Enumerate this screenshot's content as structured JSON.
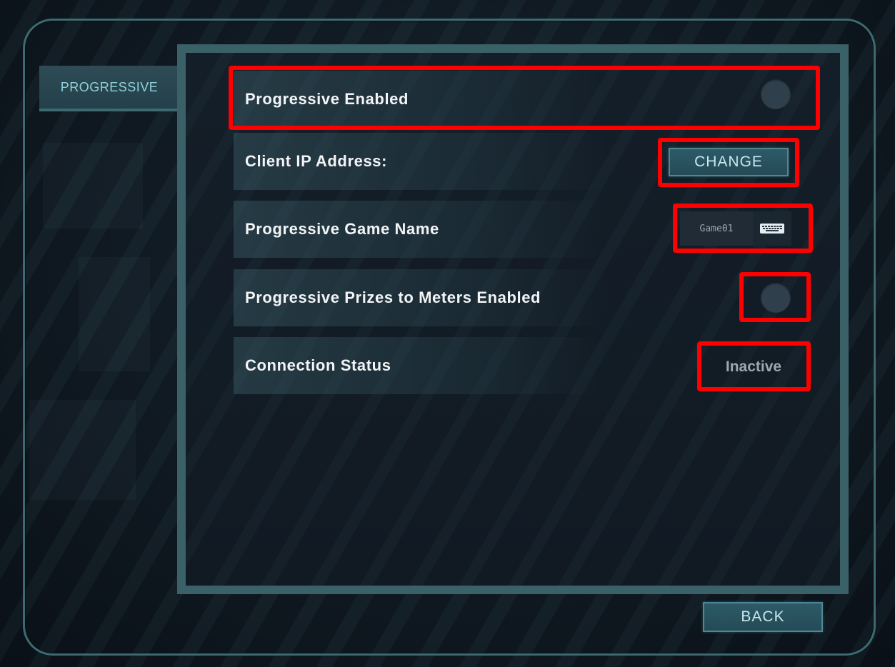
{
  "sidebar": {
    "tab_label": "PROGRESSIVE"
  },
  "settings": {
    "progressive_enabled_label": "Progressive Enabled",
    "client_ip_label": "Client IP Address:",
    "change_button_label": "CHANGE",
    "game_name_label": "Progressive Game Name",
    "game_name_value": "Game01",
    "prizes_to_meters_label": "Progressive Prizes to Meters Enabled",
    "connection_status_label": "Connection Status",
    "connection_status_value": "Inactive"
  },
  "footer": {
    "back_button_label": "BACK"
  },
  "icons": {
    "toggle": "toggle-off-icon",
    "keyboard": "keyboard-icon"
  },
  "colors": {
    "accent": "#3c6a70",
    "highlight": "#ff0000",
    "button": "#2d5a67"
  }
}
